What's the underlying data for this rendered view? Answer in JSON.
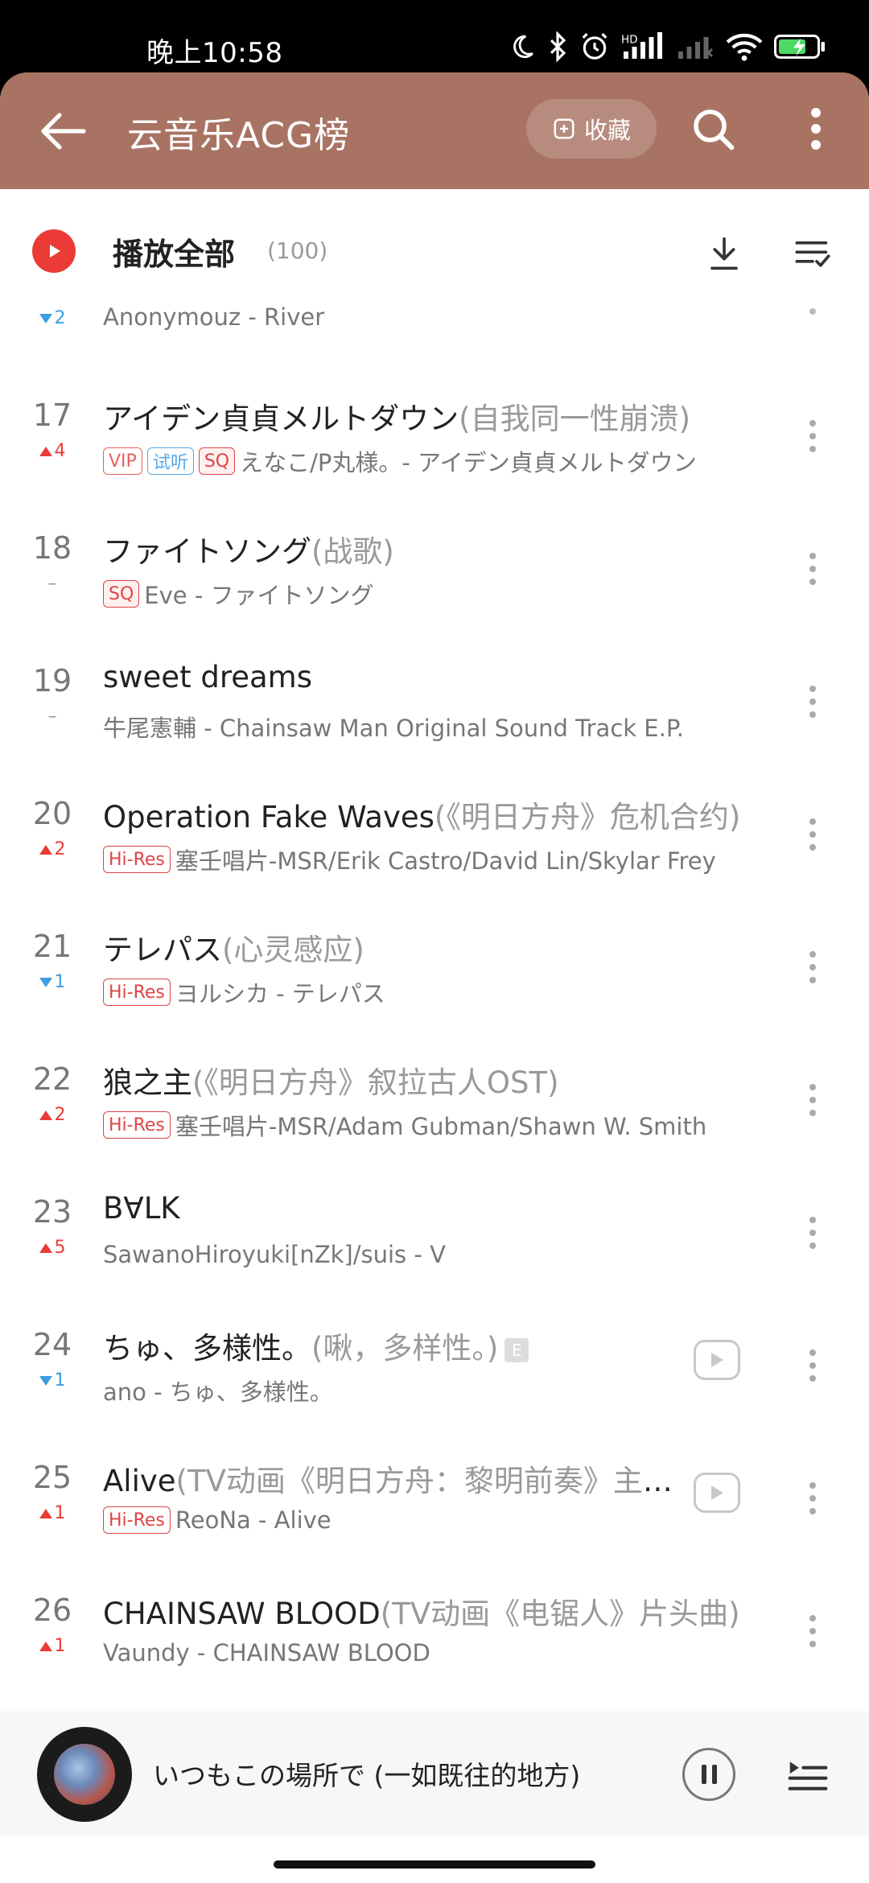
{
  "status_bar": {
    "time": "晚上10:58",
    "icons": [
      "moon-icon",
      "bluetooth-icon",
      "alarm-icon",
      "hd-signal-icon",
      "signal-icon",
      "wifi-icon",
      "battery-icon"
    ],
    "hd_label": "HD"
  },
  "header": {
    "title": "云音乐ACG榜",
    "collect_label": "收藏",
    "background_color": "#a87363"
  },
  "play_all": {
    "label": "播放全部",
    "count": "(100)"
  },
  "partial_row": {
    "change": "2",
    "direction": "down",
    "artist": "Anonymouz - River"
  },
  "songs": [
    {
      "rank": "17",
      "change": "4",
      "direction": "up",
      "title": "アイデン貞貞メルトダウン",
      "subtitle": "(自我同一性崩溃)",
      "tags": [
        "VIP",
        "试听",
        "SQ"
      ],
      "meta": "えなこ/P丸様。- アイデン貞貞メルトダウン",
      "has_mv": false
    },
    {
      "rank": "18",
      "change": "–",
      "direction": "none",
      "title": "ファイトソング",
      "subtitle": "(战歌)",
      "tags": [
        "SQ"
      ],
      "meta": "Eve - ファイトソング",
      "has_mv": false
    },
    {
      "rank": "19",
      "change": "–",
      "direction": "none",
      "title": "sweet dreams",
      "subtitle": "",
      "tags": [],
      "meta": "牛尾憲輔 - Chainsaw Man Original Sound Track E.P.",
      "has_mv": false
    },
    {
      "rank": "20",
      "change": "2",
      "direction": "up",
      "title": "Operation Fake Waves",
      "subtitle": "(《明日方舟》危机合约)",
      "tags": [
        "Hi-Res"
      ],
      "meta": "塞壬唱片-MSR/Erik Castro/David Lin/Skylar Frey",
      "has_mv": false
    },
    {
      "rank": "21",
      "change": "1",
      "direction": "down",
      "title": "テレパス",
      "subtitle": "(心灵感应)",
      "tags": [
        "Hi-Res"
      ],
      "meta": "ヨルシカ - テレパス",
      "has_mv": false
    },
    {
      "rank": "22",
      "change": "2",
      "direction": "up",
      "title": "狼之主",
      "subtitle": "(《明日方舟》叙拉古人OST)",
      "tags": [
        "Hi-Res"
      ],
      "meta": "塞壬唱片-MSR/Adam Gubman/Shawn W. Smith",
      "has_mv": false
    },
    {
      "rank": "23",
      "change": "5",
      "direction": "up",
      "title": "B∀LK",
      "subtitle": "",
      "tags": [],
      "meta": "SawanoHiroyuki[nZk]/suis - V",
      "has_mv": false
    },
    {
      "rank": "24",
      "change": "1",
      "direction": "down",
      "title": "ちゅ、多様性。",
      "subtitle": "(啾，多样性。)",
      "explicit": "E",
      "tags": [],
      "meta": "ano - ちゅ、多様性。",
      "has_mv": true
    },
    {
      "rank": "25",
      "change": "1",
      "direction": "up",
      "title": "Alive",
      "subtitle": "(TV动画《明日方舟：黎明前奏》主题曲)",
      "tags": [
        "Hi-Res"
      ],
      "meta": "ReoNa - Alive",
      "has_mv": true
    },
    {
      "rank": "26",
      "change": "1",
      "direction": "up",
      "title": "CHAINSAW BLOOD",
      "subtitle": "(TV动画《电锯人》片头曲)",
      "tags": [],
      "meta": "Vaundy - CHAINSAW BLOOD",
      "has_mv": false
    }
  ],
  "mini_player": {
    "now_playing": "いつもこの場所で (一如既往的地方)"
  }
}
